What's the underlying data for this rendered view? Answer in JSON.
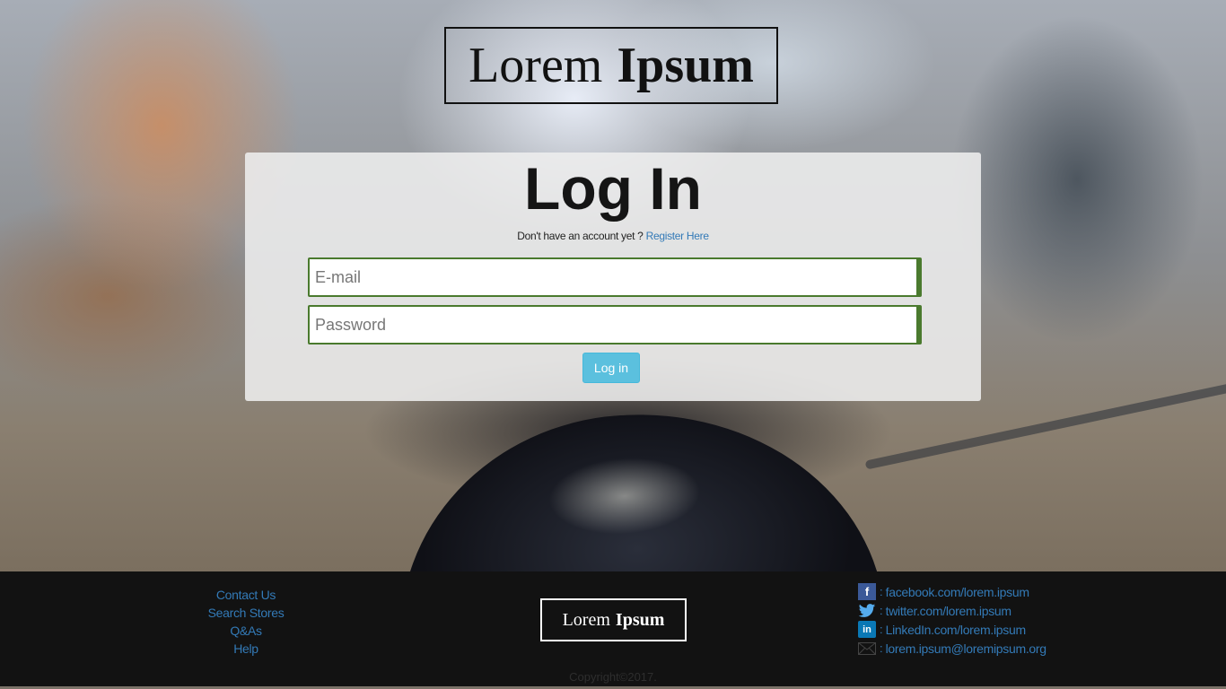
{
  "header": {
    "brand_light": "Lorem",
    "brand_bold": "Ipsum"
  },
  "login": {
    "title": "Log In",
    "no_account_text": "Don't have an account yet ?",
    "register_link": "Register Here",
    "email_placeholder": "E-mail",
    "password_placeholder": "Password",
    "submit_label": "Log in",
    "accent_color": "#5bc0de",
    "field_border_color": "#4a7a2e"
  },
  "footer": {
    "links": [
      "Contact Us",
      "Search Stores",
      "Q&As",
      "Help"
    ],
    "brand_light": "Lorem",
    "brand_bold": "Ipsum",
    "social": [
      {
        "icon": "facebook-icon",
        "separator": ":",
        "text": "facebook.com/lorem.ipsum"
      },
      {
        "icon": "twitter-icon",
        "separator": ":",
        "text": "twitter.com/lorem.ipsum"
      },
      {
        "icon": "linkedin-icon",
        "separator": ":",
        "text": "LinkedIn.com/lorem.ipsum"
      },
      {
        "icon": "mail-icon",
        "separator": ":",
        "text": "lorem.ipsum@loremipsum.org"
      }
    ],
    "copyright": "Copyright©2017.",
    "link_color": "#337ab7"
  }
}
